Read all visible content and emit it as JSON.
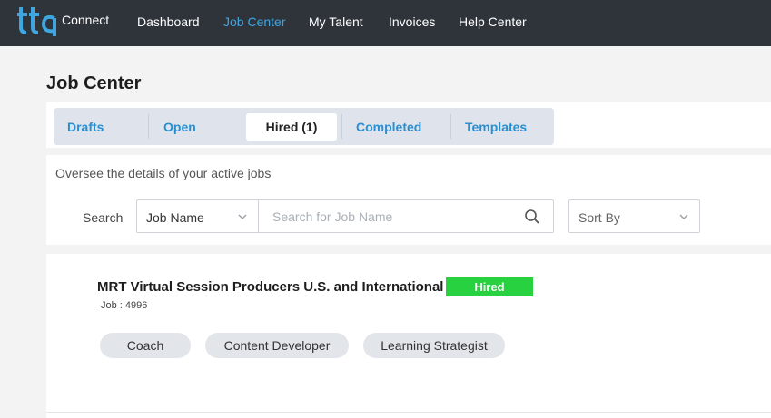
{
  "app": {
    "logo_text": "Connect",
    "logo_icon": "tta-logo-icon",
    "accent_color": "#3ea6e0"
  },
  "nav": {
    "items": [
      {
        "label": "Dashboard"
      },
      {
        "label": "Job Center",
        "active": true
      },
      {
        "label": "My Talent"
      },
      {
        "label": "Invoices"
      },
      {
        "label": "Help Center"
      }
    ]
  },
  "page": {
    "title": "Job Center",
    "subtitle": "Oversee the details of your active jobs"
  },
  "tabs": [
    {
      "label": "Drafts"
    },
    {
      "label": "Open"
    },
    {
      "label": "Hired (1)",
      "active": true
    },
    {
      "label": "Completed"
    },
    {
      "label": "Templates"
    }
  ],
  "search": {
    "label": "Search",
    "filter_value": "Job Name",
    "placeholder": "Search for Job Name",
    "value": "",
    "search_icon": "search-icon",
    "sort_placeholder": "Sort By"
  },
  "jobs": [
    {
      "title": "MRT Virtual Session Producers U.S. and International",
      "status": "Hired",
      "status_color": "#27d13f",
      "id_text": "Job : 4996",
      "tags": [
        "Coach",
        "Content Developer",
        "Learning Strategist"
      ]
    }
  ]
}
